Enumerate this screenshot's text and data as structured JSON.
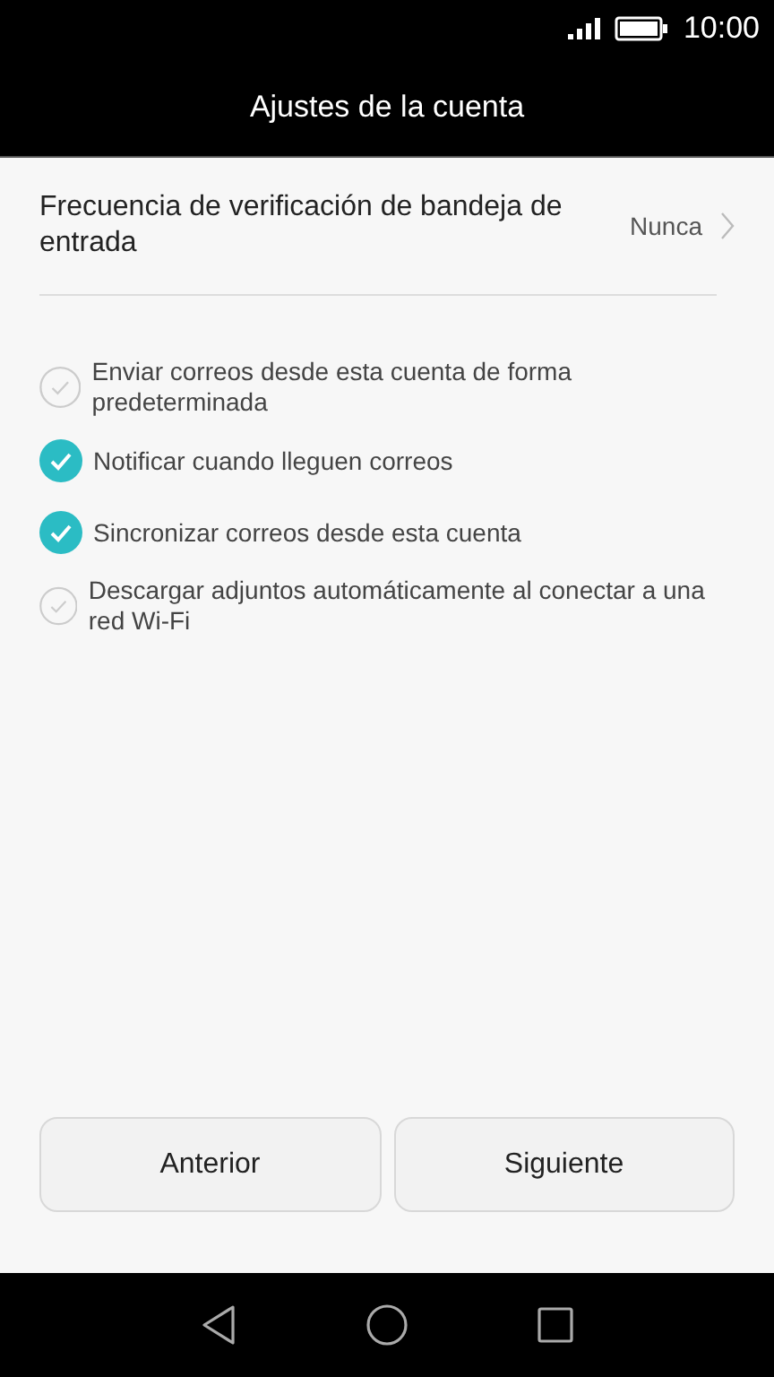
{
  "status_bar": {
    "time": "10:00"
  },
  "title": "Ajustes de la cuenta",
  "setting": {
    "label": "Frecuencia de verificación de bandeja de entrada",
    "value": "Nunca"
  },
  "options": [
    {
      "label": "Enviar correos desde esta cuenta de forma predeterminada",
      "checked": false
    },
    {
      "label": "Notificar cuando lleguen correos",
      "checked": true
    },
    {
      "label": "Sincronizar correos desde esta cuenta",
      "checked": true
    },
    {
      "label": "Descargar adjuntos automáticamente al conectar a una red Wi-Fi",
      "checked": false
    }
  ],
  "buttons": [
    "Anterior",
    "Siguiente"
  ]
}
